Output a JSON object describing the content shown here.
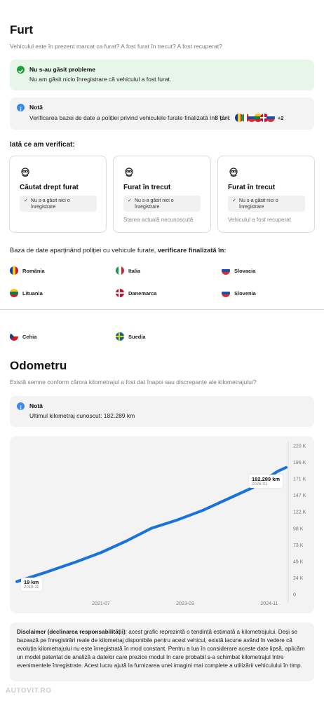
{
  "furt": {
    "title": "Furt",
    "subtitle": "Vehiculul este în prezent marcat ca furat? A fost furat în trecut? A fost recuperat?",
    "ok_alert": {
      "title": "Nu s-au găsit probleme",
      "text": "Nu am găsit nicio înregistrare că vehiculul a fost furat."
    },
    "note_alert": {
      "title": "Notă",
      "text_prefix": "Verificarea bazei de date a poliției privind vehiculele furate finalizată în ",
      "text_bold": "8 țări",
      "text_suffix": ":",
      "more": "+2"
    },
    "checked_heading": "Iată ce am verificat:",
    "cards": [
      {
        "title": "Căutat drept furat",
        "pill": "Nu s-a găsit nici o înregistrare",
        "text": ""
      },
      {
        "title": "Furat în trecut",
        "pill": "Nu s-a găsit nici o înregistrare",
        "text": "Starea actuală necunoscută"
      },
      {
        "title": "Furat în trecut",
        "pill": "Nu s-a găsit nici o înregistrare",
        "text": "Vehiculul a fost recuperat"
      }
    ],
    "db_text_prefix": "Baza de date aparținând poliției cu vehicule furate, ",
    "db_text_bold": "verificare finalizată în:",
    "countries": [
      "România",
      "Italia",
      "Slovacia",
      "Lituania",
      "Danemarca",
      "Slovenia",
      "Cehia",
      "Suedia"
    ]
  },
  "odometru": {
    "title": "Odometru",
    "subtitle": "Există semne conform cărora kilometrajul a fost dat înapoi sau discrepanțe ale kilometrajului?",
    "note_alert": {
      "title": "Notă",
      "text": "Ultimul kilometraj cunoscut: 182.289 km"
    },
    "disclaimer_bold": "Disclaimer (declinarea responsabilității)",
    "disclaimer_text": ": acest grafic reprezintă o tendință estimată a kilometrajului. Deși se bazează pe înregistrări reale de kilometraj disponibile pentru acest vehicul, există lacune având în vedere că evoluția kilometrajului nu este înregistrată în mod constant. Pentru a lua în considerare aceste date lipsă, aplicăm un model patentat de analiză a datelor care prezice modul în care probabil s-a schimbat kilometrajul între evenimentele înregistrate. Acest lucru ajută la furnizarea unei imagini mai complete a utilizării vehiculului în timp."
  },
  "chart_data": {
    "type": "line",
    "title": "",
    "xlabel": "",
    "ylabel": "",
    "x_ticks": [
      "2021-07",
      "2023-03",
      "2024-11"
    ],
    "y_ticks": [
      "0",
      "24 K",
      "49 K",
      "73 K",
      "98 K",
      "122 K",
      "147 K",
      "171 K",
      "196 K",
      "220 K"
    ],
    "ylim": [
      0,
      220000
    ],
    "xlim": [
      "2019-11",
      "2025-03"
    ],
    "series": [
      {
        "name": "",
        "color": "#1a73d9",
        "x": [
          "2019-11",
          "2020-06",
          "2021-01",
          "2021-07",
          "2022-01",
          "2022-07",
          "2023-01",
          "2023-07",
          "2024-01",
          "2024-07",
          "2025-01",
          "2025-03"
        ],
        "y": [
          19000,
          33000,
          48000,
          62000,
          79000,
          98000,
          110000,
          124000,
          141000,
          158000,
          182289,
          188000
        ]
      }
    ],
    "annotations": [
      {
        "value": "19 km",
        "date": "2019-11"
      },
      {
        "value": "182.289 km",
        "date": "2025-01"
      }
    ],
    "grid": false,
    "line_color": "#1a73d9"
  },
  "watermark": "AUTOVIT.RO"
}
